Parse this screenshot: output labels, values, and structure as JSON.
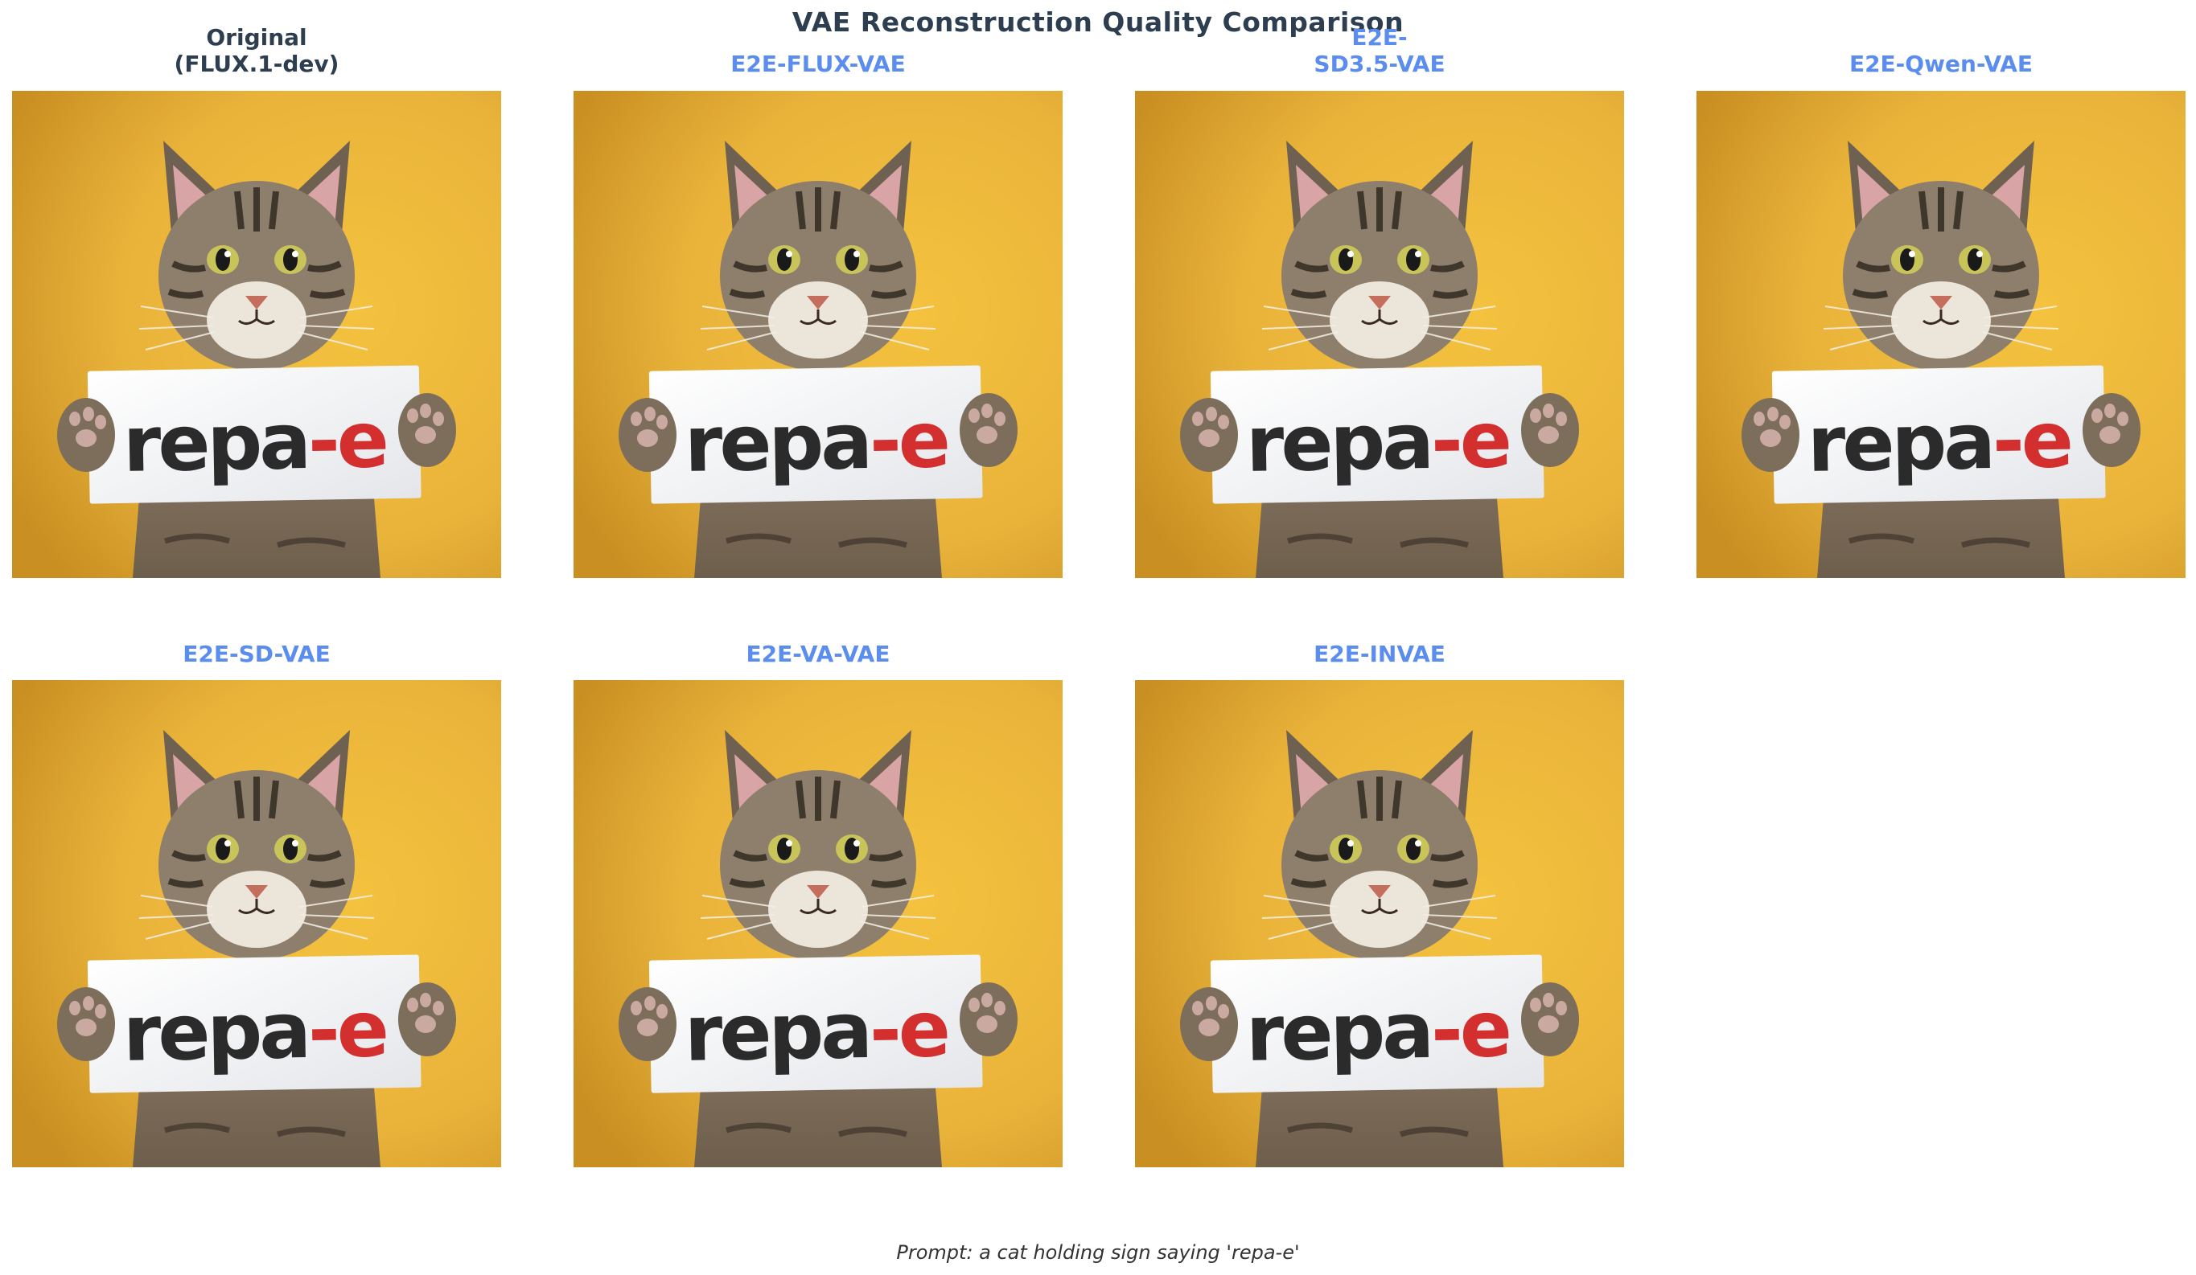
{
  "title": "VAE Reconstruction Quality Comparison",
  "colors": {
    "title": "#2c3e50",
    "original_label": "#2c3e50",
    "model_label": "#5b8def",
    "background_yellow": "#eab73a",
    "sign_text_dark": "#2b2b2b",
    "sign_text_red": "#d32f2f"
  },
  "panels": [
    {
      "label_lines": [
        "Original",
        "(FLUX.1-dev)"
      ],
      "sign": {
        "dark": "repa",
        "red": "-e"
      }
    },
    {
      "label_lines": [
        "E2E-FLUX-VAE"
      ],
      "sign": {
        "dark": "repa",
        "red": "-e"
      }
    },
    {
      "label_lines": [
        "E2E-",
        "SD3.5-VAE"
      ],
      "sign": {
        "dark": "repa",
        "red": "-e"
      }
    },
    {
      "label_lines": [
        "E2E-Qwen-VAE"
      ],
      "sign": {
        "dark": "repa",
        "red": "-e"
      }
    },
    {
      "label_lines": [
        "E2E-SD-VAE"
      ],
      "sign": {
        "dark": "repa",
        "red": "-e"
      }
    },
    {
      "label_lines": [
        "E2E-VA-VAE"
      ],
      "sign": {
        "dark": "repa",
        "red": "-e"
      }
    },
    {
      "label_lines": [
        "E2E-INVAE"
      ],
      "sign": {
        "dark": "repa",
        "red": "-e"
      }
    }
  ],
  "prompt": "Prompt: a cat holding sign saying 'repa-e'"
}
